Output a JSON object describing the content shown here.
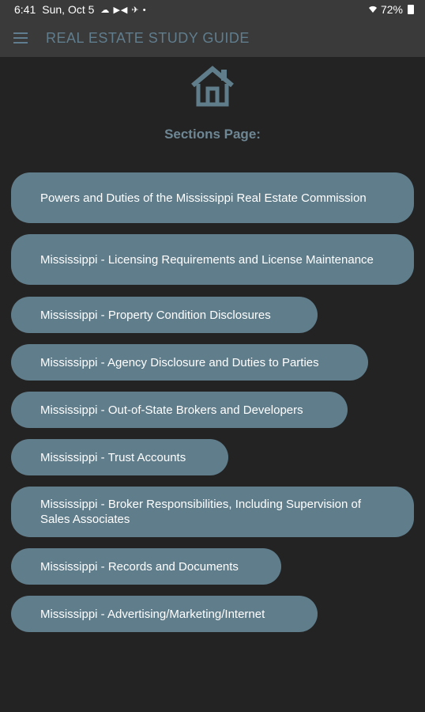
{
  "status_bar": {
    "time": "6:41",
    "date": "Sun, Oct 5",
    "icons": "☁ ▶◀ ✈ •",
    "battery": "72%"
  },
  "app_bar": {
    "menu_icon": "menu-icon",
    "title": "REAL ESTATE STUDY GUIDE"
  },
  "header": {
    "icon": "home-icon",
    "heading": "Sections Page:"
  },
  "colors": {
    "background": "#232323",
    "app_bar": "#3a3a3a",
    "accent": "#607d8b"
  },
  "sections": [
    "Powers and Duties of the Mississippi Real Estate Commission",
    "Mississippi - Licensing Requirements and License Maintenance",
    "Mississippi - Property Condition Disclosures",
    "Mississippi - Agency Disclosure and Duties to Parties",
    "Mississippi - Out-of-State Brokers and Developers",
    "Mississippi - Trust Accounts",
    "Mississippi - Broker Responsibilities, Including Supervision of Sales Associates",
    "Mississippi - Records and Documents",
    "Mississippi - Advertising/Marketing/Internet"
  ]
}
